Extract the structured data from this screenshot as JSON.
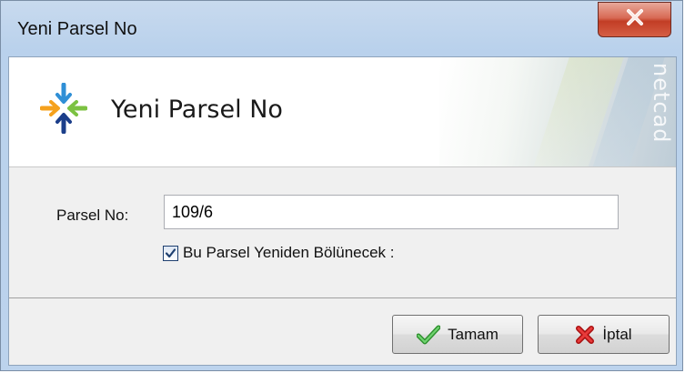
{
  "window": {
    "title": "Yeni Parsel No",
    "close_icon": "close-icon"
  },
  "banner": {
    "title": "Yeni Parsel No",
    "watermark": "netcad",
    "logo_icon": "netcad-logo-icon"
  },
  "form": {
    "parcel_label": "Parsel No:",
    "parcel_value": "109/6",
    "resplit_checkbox_label": "Bu Parsel Yeniden Bölünecek :",
    "resplit_checked": true
  },
  "buttons": {
    "ok_label": "Tamam",
    "ok_icon": "checkmark-icon",
    "cancel_label": "İptal",
    "cancel_icon": "red-x-icon"
  },
  "colors": {
    "close_button": "#c23d25",
    "ok_check": "#3aa63a",
    "cancel_x": "#d01818"
  }
}
